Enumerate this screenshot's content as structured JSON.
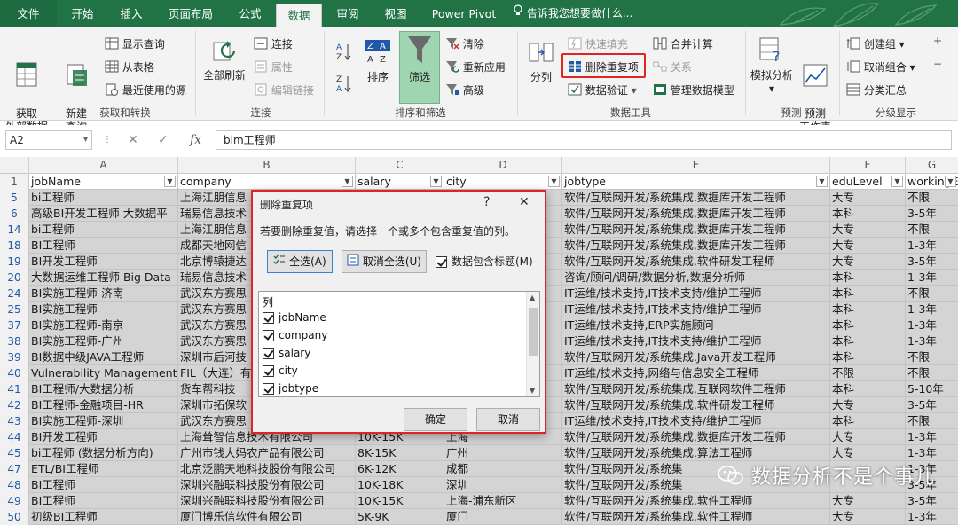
{
  "tabs": [
    "文件",
    "开始",
    "插入",
    "页面布局",
    "公式",
    "数据",
    "审阅",
    "视图",
    "Power Pivot"
  ],
  "tell_me": "告诉我您想要做什么...",
  "ribbon": {
    "get_external": "获取\n外部数据",
    "new_query": "新建\n查询",
    "show_query": "显示查询",
    "from_table": "从表格",
    "recent_sources": "最近使用的源",
    "grp_get": "获取和转换",
    "refresh_all": "全部刷新",
    "connections": "连接",
    "properties": "属性",
    "edit_links": "编辑链接",
    "grp_conn": "连接",
    "sort": "排序",
    "filter": "筛选",
    "clear": "清除",
    "reapply": "重新应用",
    "advanced": "高级",
    "grp_sort": "排序和筛选",
    "split": "分列",
    "flash_fill": "快速填充",
    "remove_dup": "删除重复项",
    "validation": "数据验证",
    "consolidate": "合并计算",
    "relations": "关系",
    "manage_model": "管理数据模型",
    "grp_tools": "数据工具",
    "whatif": "模拟分析",
    "forecast": "预测\n工作表",
    "grp_forecast": "预测",
    "group": "创建组",
    "ungroup": "取消组合",
    "subtotal": "分类汇总",
    "grp_outline": "分级显示"
  },
  "formula_bar": {
    "name_box": "A2",
    "fx": "fx",
    "value": "bim工程师"
  },
  "columns": [
    "A",
    "B",
    "C",
    "D",
    "E",
    "F",
    "G"
  ],
  "header_row": {
    "num": "1",
    "cells": [
      "jobName",
      "company",
      "salary",
      "city",
      "jobtype",
      "eduLevel",
      "workingE"
    ]
  },
  "rows": [
    {
      "num": "5",
      "cells": [
        "bi工程师",
        "上海江朋信息",
        "",
        "",
        "软件/互联网开发/系统集成,数据库开发工程师",
        "大专",
        "不限"
      ]
    },
    {
      "num": "6",
      "cells": [
        "高级BI开发工程师 大数据平",
        "瑞易信息技术",
        "",
        "",
        "软件/互联网开发/系统集成,数据库开发工程师",
        "本科",
        "3-5年"
      ]
    },
    {
      "num": "14",
      "cells": [
        "bi工程师",
        "上海江朋信息",
        "",
        "",
        "软件/互联网开发/系统集成,数据库开发工程师",
        "大专",
        "不限"
      ]
    },
    {
      "num": "18",
      "cells": [
        "BI工程师",
        "成都天地网信",
        "",
        "",
        "软件/互联网开发/系统集成,数据库开发工程师",
        "大专",
        "1-3年"
      ]
    },
    {
      "num": "19",
      "cells": [
        "BI开发工程师",
        "北京博辕捷达",
        "",
        "",
        "软件/互联网开发/系统集成,软件研发工程师",
        "大专",
        "3-5年"
      ]
    },
    {
      "num": "20",
      "cells": [
        "大数据运维工程师 Big Data",
        "瑞易信息技术",
        "",
        "",
        "咨询/顾问/调研/数据分析,数据分析师",
        "本科",
        "1-3年"
      ]
    },
    {
      "num": "24",
      "cells": [
        "BI实施工程师-济南",
        "武汉东方赛思",
        "",
        "",
        "IT运维/技术支持,IT技术支持/维护工程师",
        "本科",
        "不限"
      ]
    },
    {
      "num": "25",
      "cells": [
        "BI实施工程师",
        "武汉东方赛思",
        "",
        "",
        "IT运维/技术支持,IT技术支持/维护工程师",
        "本科",
        "1-3年"
      ]
    },
    {
      "num": "37",
      "cells": [
        "BI实施工程师-南京",
        "武汉东方赛思",
        "",
        "",
        "IT运维/技术支持,ERP实施顾问",
        "本科",
        "1-3年"
      ]
    },
    {
      "num": "38",
      "cells": [
        "BI实施工程师-广州",
        "武汉东方赛思",
        "",
        "",
        "IT运维/技术支持,IT技术支持/维护工程师",
        "本科",
        "1-3年"
      ]
    },
    {
      "num": "39",
      "cells": [
        "BI数据中级JAVA工程师",
        "深圳市后河技",
        "",
        "",
        "软件/互联网开发/系统集成,Java开发工程师",
        "本科",
        "不限"
      ]
    },
    {
      "num": "40",
      "cells": [
        "Vulnerability Management",
        "FIL（大连）有",
        "",
        "",
        "IT运维/技术支持,网络与信息安全工程师",
        "不限",
        "不限"
      ]
    },
    {
      "num": "41",
      "cells": [
        "BI工程师/大数据分析",
        "货车帮科技",
        "",
        "",
        "软件/互联网开发/系统集成,互联网软件工程师",
        "本科",
        "5-10年"
      ]
    },
    {
      "num": "42",
      "cells": [
        "BI工程师-金融项目-HR",
        "深圳市拓保软",
        "",
        "",
        "软件/互联网开发/系统集成,软件研发工程师",
        "大专",
        "3-5年"
      ]
    },
    {
      "num": "43",
      "cells": [
        "BI实施工程师-深圳",
        "武汉东方赛思",
        "",
        "",
        "IT运维/技术支持,IT技术支持/维护工程师",
        "本科",
        "不限"
      ]
    },
    {
      "num": "44",
      "cells": [
        "BI开发工程师",
        "上海耸智信息技术有限公司",
        "10K-15K",
        "上海",
        "软件/互联网开发/系统集成,数据库开发工程师",
        "大专",
        "1-3年"
      ]
    },
    {
      "num": "45",
      "cells": [
        "bi工程师 (数据分析方向)",
        "广州市钱大妈农产品有限公司",
        "8K-15K",
        "广州",
        "软件/互联网开发/系统集成,算法工程师",
        "大专",
        "1-3年"
      ]
    },
    {
      "num": "47",
      "cells": [
        "ETL/BI工程师",
        "北京泛鹏天地科技股份有限公司",
        "6K-12K",
        "成都",
        "软件/互联网开发/系统集",
        "",
        "1-3年"
      ]
    },
    {
      "num": "48",
      "cells": [
        "BI工程师",
        "深圳兴融联科技股份有限公司",
        "10K-18K",
        "深圳",
        "软件/互联网开发/系统集",
        "",
        "3-5年"
      ]
    },
    {
      "num": "49",
      "cells": [
        "BI工程师",
        "深圳兴融联科技股份有限公司",
        "10K-15K",
        "上海-浦东新区",
        "软件/互联网开发/系统集成,软件工程师",
        "大专",
        "3-5年"
      ]
    },
    {
      "num": "50",
      "cells": [
        "初级BI工程师",
        "厦门博乐信软件有限公司",
        "5K-9K",
        "厦门",
        "软件/互联网开发/系统集成,软件工程师",
        "大专",
        "1-3年"
      ]
    }
  ],
  "dialog": {
    "title": "删除重复项",
    "help": "?",
    "close": "✕",
    "message": "若要删除重复值，请选择一个或多个包含重复值的列。",
    "select_all": "全选(A)",
    "unselect_all": "取消全选(U)",
    "has_header": "数据包含标题(M)",
    "list_header": "列",
    "items": [
      "jobName",
      "company",
      "salary",
      "city",
      "jobtype"
    ],
    "ok": "确定",
    "cancel": "取消"
  },
  "watermark": "数据分析不是个事儿"
}
